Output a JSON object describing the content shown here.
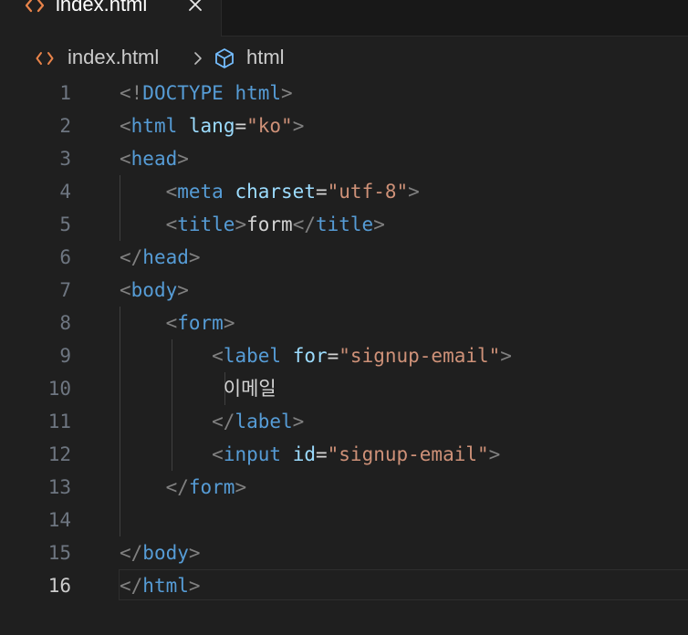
{
  "tab": {
    "label": "index.html"
  },
  "breadcrumb": {
    "file": "index.html",
    "symbol": "html"
  },
  "colors": {
    "tag": "#569cd6",
    "attribute": "#9cdcfe",
    "string": "#ce9178",
    "punctuation": "#808080",
    "text": "#d4d4d4",
    "file_icon": "#e8834a"
  },
  "lines": [
    {
      "number": "1",
      "tokens": [
        [
          "p",
          "<!"
        ],
        [
          "d",
          "DOCTYPE"
        ],
        [
          "e",
          " "
        ],
        [
          "t",
          "html"
        ],
        [
          "p",
          ">"
        ]
      ]
    },
    {
      "number": "2",
      "tokens": [
        [
          "p",
          "<"
        ],
        [
          "t",
          "html"
        ],
        [
          "e",
          " "
        ],
        [
          "a",
          "lang"
        ],
        [
          "e",
          "="
        ],
        [
          "s",
          "\"ko\""
        ],
        [
          "p",
          ">"
        ]
      ]
    },
    {
      "number": "3",
      "tokens": [
        [
          "p",
          "<"
        ],
        [
          "t",
          "head"
        ],
        [
          "p",
          ">"
        ]
      ]
    },
    {
      "number": "4",
      "tokens": [
        [
          "e",
          "    "
        ],
        [
          "p",
          "<"
        ],
        [
          "t",
          "meta"
        ],
        [
          "e",
          " "
        ],
        [
          "a",
          "charset"
        ],
        [
          "e",
          "="
        ],
        [
          "s",
          "\"utf-8\""
        ],
        [
          "p",
          ">"
        ]
      ]
    },
    {
      "number": "5",
      "tokens": [
        [
          "e",
          "    "
        ],
        [
          "p",
          "<"
        ],
        [
          "t",
          "title"
        ],
        [
          "p",
          ">"
        ],
        [
          "e",
          "form"
        ],
        [
          "p",
          "</"
        ],
        [
          "t",
          "title"
        ],
        [
          "p",
          ">"
        ]
      ]
    },
    {
      "number": "6",
      "tokens": [
        [
          "p",
          "</"
        ],
        [
          "t",
          "head"
        ],
        [
          "p",
          ">"
        ]
      ]
    },
    {
      "number": "7",
      "tokens": [
        [
          "p",
          "<"
        ],
        [
          "t",
          "body"
        ],
        [
          "p",
          ">"
        ]
      ]
    },
    {
      "number": "8",
      "tokens": [
        [
          "e",
          "    "
        ],
        [
          "p",
          "<"
        ],
        [
          "t",
          "form"
        ],
        [
          "p",
          ">"
        ]
      ]
    },
    {
      "number": "9",
      "tokens": [
        [
          "e",
          "        "
        ],
        [
          "p",
          "<"
        ],
        [
          "t",
          "label"
        ],
        [
          "e",
          " "
        ],
        [
          "a",
          "for"
        ],
        [
          "e",
          "="
        ],
        [
          "s",
          "\"signup-email\""
        ],
        [
          "p",
          ">"
        ]
      ]
    },
    {
      "number": "10",
      "tokens": [
        [
          "e",
          "         "
        ],
        [
          "tx",
          "이메일"
        ]
      ]
    },
    {
      "number": "11",
      "tokens": [
        [
          "e",
          "        "
        ],
        [
          "p",
          "</"
        ],
        [
          "t",
          "label"
        ],
        [
          "p",
          ">"
        ]
      ]
    },
    {
      "number": "12",
      "tokens": [
        [
          "e",
          "        "
        ],
        [
          "p",
          "<"
        ],
        [
          "t",
          "input"
        ],
        [
          "e",
          " "
        ],
        [
          "a",
          "id"
        ],
        [
          "e",
          "="
        ],
        [
          "s",
          "\"signup-email\""
        ],
        [
          "p",
          ">"
        ]
      ]
    },
    {
      "number": "13",
      "tokens": [
        [
          "e",
          "    "
        ],
        [
          "p",
          "</"
        ],
        [
          "t",
          "form"
        ],
        [
          "p",
          ">"
        ]
      ]
    },
    {
      "number": "14",
      "tokens": []
    },
    {
      "number": "15",
      "tokens": [
        [
          "p",
          "</"
        ],
        [
          "t",
          "body"
        ],
        [
          "p",
          ">"
        ]
      ]
    },
    {
      "number": "16",
      "tokens": [
        [
          "p",
          "</"
        ],
        [
          "t",
          "html"
        ],
        [
          "p",
          ">"
        ]
      ]
    }
  ],
  "active_line": "16"
}
